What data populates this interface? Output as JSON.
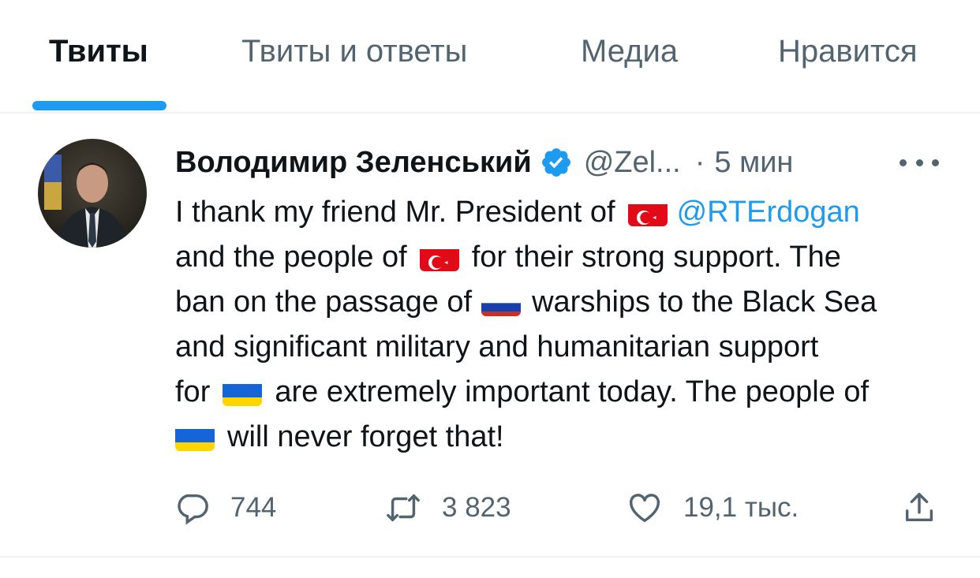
{
  "tabs": [
    {
      "label": "Твиты",
      "active": true
    },
    {
      "label": "Твиты и ответы",
      "active": false
    },
    {
      "label": "Медиа",
      "active": false
    },
    {
      "label": "Нравится",
      "active": false
    }
  ],
  "tweet": {
    "author_name": "Володимир Зеленський",
    "handle": "@Zel...",
    "separator": "·",
    "time": "5 мин",
    "lines": {
      "l1a": "I thank my friend Mr. President of",
      "l1_mention": "@RTErdogan",
      "l2a": "and the people of",
      "l2b": "for their strong support. The",
      "l3a": "ban on the passage of",
      "l3b": "warships to the Black Sea",
      "l4": "and significant military and humanitarian support",
      "l5a": "for",
      "l5b": "are extremely important today. The people of",
      "l6": "will never forget that!"
    },
    "stats": {
      "replies": "744",
      "retweets": "3 823",
      "likes": "19,1 тыс."
    }
  },
  "colors": {
    "accent": "#1d9bf0",
    "text": "#0f1419",
    "secondary": "#536471"
  }
}
